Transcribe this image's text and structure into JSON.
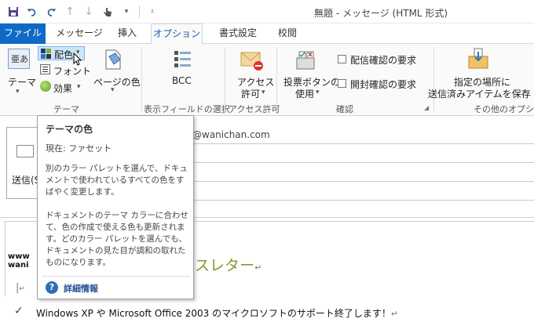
{
  "window": {
    "title": "無題 - メッセージ (HTML 形式)"
  },
  "qat": {
    "icons": [
      "save-icon",
      "undo-icon",
      "redo-icon",
      "up-icon",
      "down-icon",
      "touch-icon"
    ]
  },
  "tabs": [
    "ファイル",
    "メッセージ",
    "挿入",
    "オプション",
    "書式設定",
    "校閲"
  ],
  "ribbon": {
    "theme": {
      "theme_label": "テーマ",
      "colors_label": "配色",
      "fonts_label": "フォント",
      "effects_label": "効果",
      "page_color_label": "ページの色",
      "group_label": "テーマ"
    },
    "fields": {
      "bcc_label": "BCC",
      "group_label": "表示フィールドの選択"
    },
    "permission": {
      "label_line1": "アクセス",
      "label_line2": "許可",
      "group_label": "アクセス許可"
    },
    "tracking": {
      "voting_line1": "投票ボタンの",
      "voting_line2": "使用",
      "request_delivery": "配信確認の要求",
      "request_read": "開封確認の要求",
      "group_label": "確認"
    },
    "more": {
      "label_line1": "指定の場所に",
      "label_line2": "送信済みアイテムを保存",
      "group_label": "その他のオプション"
    }
  },
  "header": {
    "send_label": "送信(S)",
    "from_address": "@wanichan.com"
  },
  "body": {
    "www_line1": "www",
    "www_line2": "wani",
    "newsletter_title": "ースレター",
    "paragraph_mark": "↵",
    "support_text": "Windows XP や Microsoft Office 2003 のマイクロソフトのサポート終了します！"
  },
  "tooltip": {
    "title": "テーマの色",
    "current": "現在: ファセット",
    "para1": "別のカラー パレットを選んで、ドキュメントで使われているすべての色をすばやく変更します。",
    "para2": "ドキュメントのテーマ カラーに合わせて、色の作成で使える色も更新されます。どのカラー パレットを選んでも、ドキュメントの見た目が調和の取れたものになります。",
    "link": "詳細情報"
  },
  "colors": {
    "accent": "#0f6ac6",
    "newsletter": "#7d9b2a"
  }
}
